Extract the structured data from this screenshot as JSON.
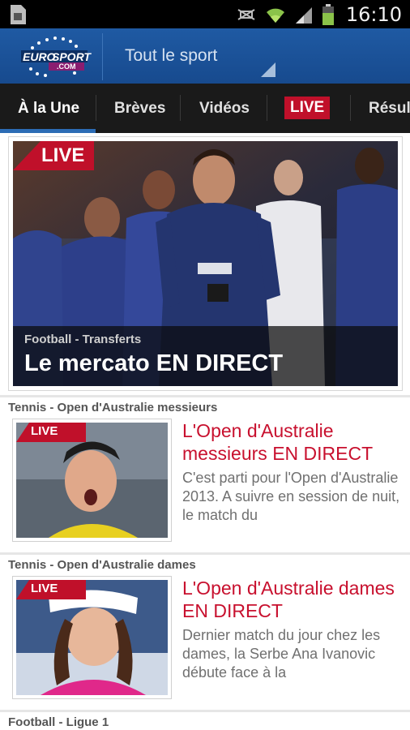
{
  "status_bar": {
    "time": "16:10",
    "icons": [
      "sim-icon",
      "mute-icon",
      "wifi-icon",
      "signal-icon",
      "battery-icon"
    ]
  },
  "header": {
    "logo_text_1": "EURO",
    "logo_text_2": "SPORT",
    "logo_text_3": ".COM",
    "section_title": "Tout le sport"
  },
  "tabs": [
    {
      "label": "À la Une",
      "active": true
    },
    {
      "label": "Brèves"
    },
    {
      "label": "Vidéos"
    },
    {
      "label": "LIVE",
      "highlight": true
    },
    {
      "label": "Résultats"
    }
  ],
  "hero": {
    "badge": "LIVE",
    "category": "Football - Transferts",
    "title": "Le mercato EN DIRECT"
  },
  "articles": [
    {
      "category": "Tennis - Open d'Australie messieurs",
      "badge": "LIVE",
      "title": "L'Open d'Australie messieurs EN DIRECT",
      "summary": "C'est parti pour l'Open d'Australie 2013. A suivre en session de nuit, le match du"
    },
    {
      "category": "Tennis - Open d'Australie dames",
      "badge": "LIVE",
      "title": "L'Open d'Australie dames EN DIRECT",
      "summary": "Dernier match du jour chez les dames, la Serbe Ana Ivanovic débute face à la"
    },
    {
      "category": "Football - Ligue 1"
    }
  ],
  "colors": {
    "brand_blue": "#1f5aa3",
    "live_red": "#c0102a",
    "headline_red": "#c8102e",
    "tab_bar": "#1a1a1a"
  }
}
